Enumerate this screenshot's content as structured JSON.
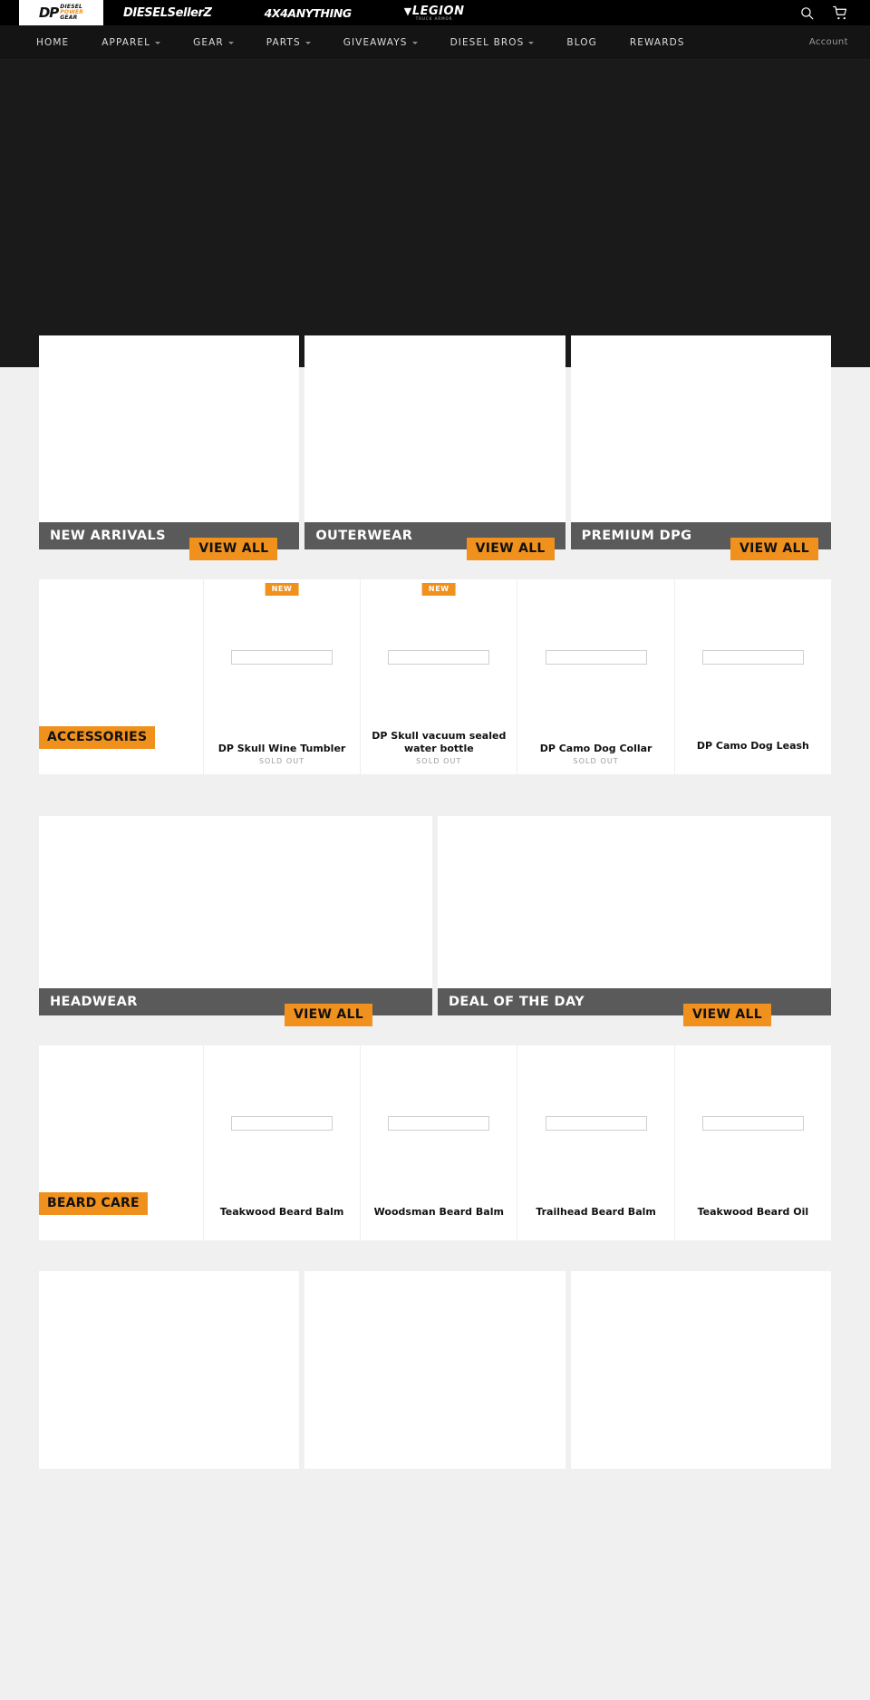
{
  "brandbar": {
    "logos": [
      {
        "name": "diesel-power-gear",
        "mark": "DP",
        "line1": "DIESEL",
        "line2": "POWER",
        "line3": "GEAR"
      },
      {
        "name": "dieselsellerz",
        "text": "DIESELSellerZ"
      },
      {
        "name": "4x4anything",
        "text": "4X4ANYTHING"
      },
      {
        "name": "legion-truck-armor",
        "text": "LEGION",
        "sub": "TRUCK ARMOR"
      }
    ],
    "search_icon": "search-icon",
    "cart_icon": "shopping-cart-icon"
  },
  "nav": {
    "items": [
      {
        "label": "HOME",
        "has_dropdown": false
      },
      {
        "label": "APPAREL",
        "has_dropdown": true
      },
      {
        "label": "GEAR",
        "has_dropdown": true
      },
      {
        "label": "PARTS",
        "has_dropdown": true
      },
      {
        "label": "GIVEAWAYS",
        "has_dropdown": true
      },
      {
        "label": "DIESEL BROS",
        "has_dropdown": true
      },
      {
        "label": "BLOG",
        "has_dropdown": false
      },
      {
        "label": "REWARDS",
        "has_dropdown": false
      }
    ],
    "account_label": "Account"
  },
  "colors": {
    "brand_orange": "#f0911e",
    "bar_gray": "#5a5a5a",
    "hero_black": "#1a1a1a",
    "page_bg": "#f0f0f0",
    "nav_black": "#141414"
  },
  "category_row_1": [
    {
      "title": "NEW ARRIVALS",
      "cta": "VIEW ALL"
    },
    {
      "title": "OUTERWEAR",
      "cta": "VIEW ALL"
    },
    {
      "title": "PREMIUM DPG",
      "cta": "VIEW ALL"
    }
  ],
  "accessories_strip": {
    "promo_label": "ACCESSORIES",
    "products": [
      {
        "title": "DP Skull Wine Tumbler",
        "badge": "NEW",
        "status": "SOLD OUT"
      },
      {
        "title": "DP Skull vacuum sealed water bottle",
        "badge": "NEW",
        "status": "SOLD OUT"
      },
      {
        "title": "DP Camo Dog Collar",
        "badge": "",
        "status": "SOLD OUT"
      },
      {
        "title": "DP Camo Dog Leash",
        "badge": "",
        "status": ""
      }
    ]
  },
  "category_row_2": [
    {
      "title": "HEADWEAR",
      "cta": "VIEW ALL"
    },
    {
      "title": "DEAL OF THE DAY",
      "cta": "VIEW ALL"
    }
  ],
  "beard_strip": {
    "promo_label": "BEARD CARE",
    "products": [
      {
        "title": "Teakwood Beard Balm",
        "badge": "",
        "status": ""
      },
      {
        "title": "Woodsman Beard Balm",
        "badge": "",
        "status": ""
      },
      {
        "title": "Trailhead Beard Balm",
        "badge": "",
        "status": ""
      },
      {
        "title": "Teakwood Beard Oil",
        "badge": "",
        "status": ""
      }
    ]
  },
  "bottom_tiles": [
    {
      "name": "bottom-tile-1"
    },
    {
      "name": "bottom-tile-2"
    },
    {
      "name": "bottom-tile-3"
    }
  ]
}
